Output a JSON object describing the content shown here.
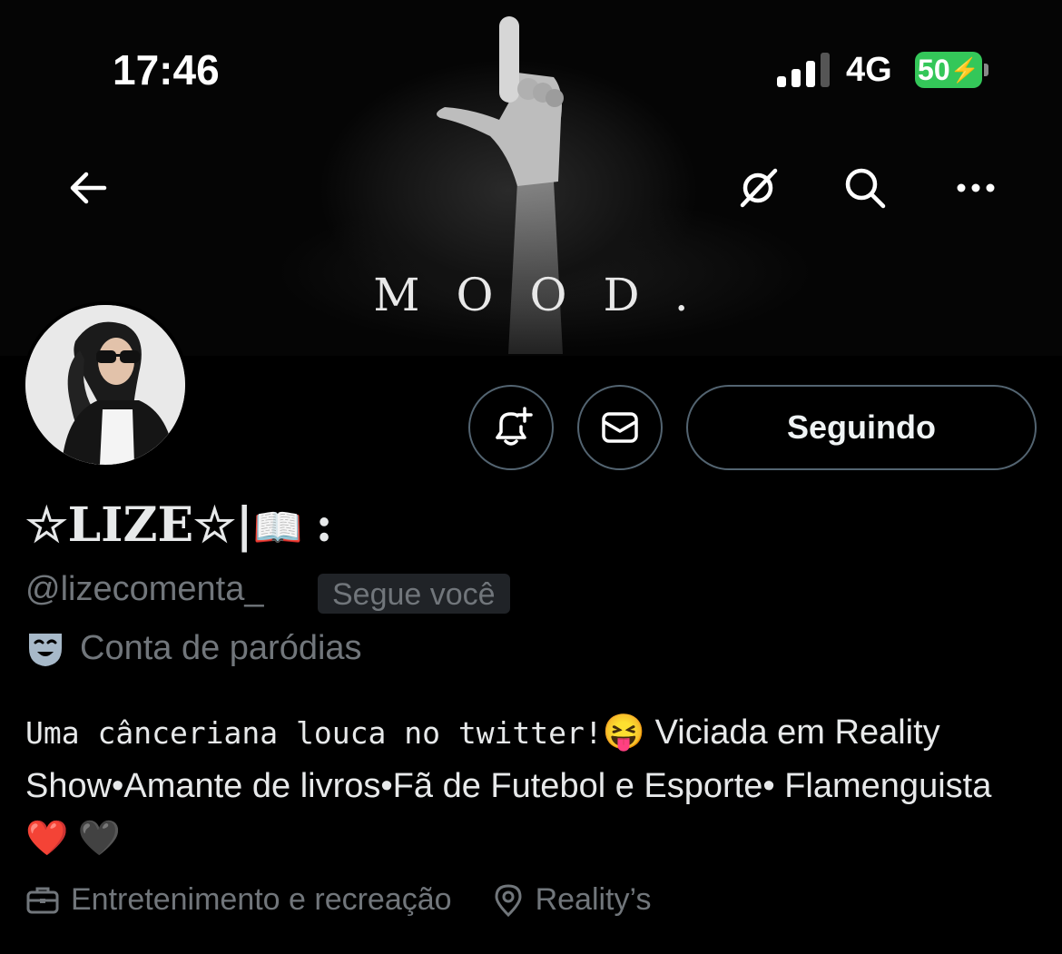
{
  "status_bar": {
    "time": "17:46",
    "network": "4G",
    "battery_percent": "50",
    "battery_color": "#34c759"
  },
  "nav": {
    "back_icon": "back-arrow-icon",
    "grok_icon": "grok-icon",
    "search_icon": "search-icon",
    "more_icon": "more-icon"
  },
  "banner": {
    "text": "MOOD."
  },
  "actions": {
    "follow_label": "Seguindo"
  },
  "profile": {
    "display_name_prefix": "☆LIZE☆|",
    "display_name_book": "📖",
    "display_name_suffix": ":",
    "handle": "@lizecomenta_",
    "follows_you": "Segue você",
    "parody_label": "Conta de paródias",
    "bio_mono": "Uma cânceriana louca no twitter!",
    "bio_emoji_1": "😝",
    "bio_part_2": " Viciada em Reality Show•Amante de livros•Fã de Futebol e Esporte• Flamenguista",
    "bio_emoji_2": "❤️",
    "bio_emoji_3": " 🖤",
    "category": "Entretenimento e recreação",
    "location": "Reality’s"
  },
  "colors": {
    "muted": "#71767b",
    "border": "#536471",
    "text": "#e7e9ea"
  }
}
